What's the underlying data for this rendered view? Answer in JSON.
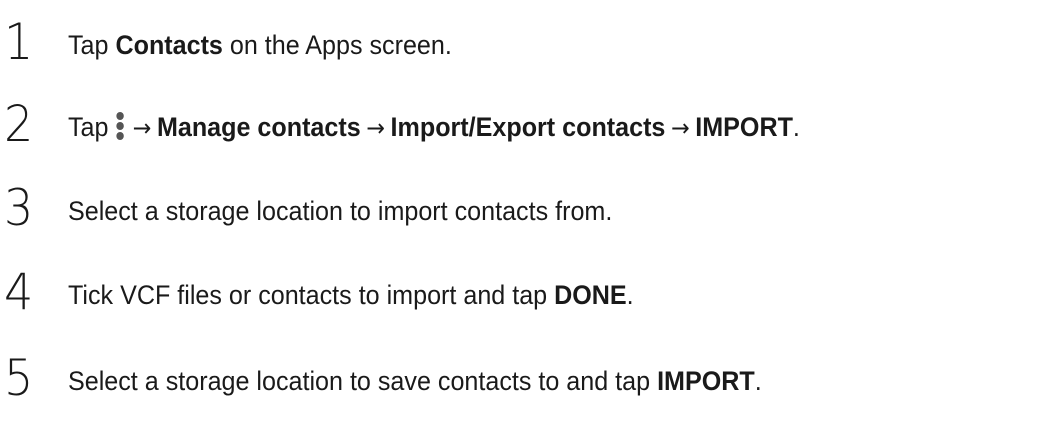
{
  "steps": [
    {
      "number": "1",
      "parts": {
        "t1": "Tap ",
        "b1": "Contacts",
        "t2": " on the Apps screen."
      }
    },
    {
      "number": "2",
      "parts": {
        "t1": "Tap",
        "icon": "more-options-icon",
        "arrow": "→",
        "b1": "Manage contacts",
        "b2": "Import/Export contacts",
        "b3": "IMPORT",
        "end": "."
      }
    },
    {
      "number": "3",
      "parts": {
        "t1": "Select a storage location to import contacts from."
      }
    },
    {
      "number": "4",
      "parts": {
        "t1": "Tick VCF files or contacts to import and tap ",
        "b1": "DONE",
        "end": "."
      }
    },
    {
      "number": "5",
      "parts": {
        "t1": "Select a storage location to save contacts to and tap ",
        "b1": "IMPORT",
        "end": "."
      }
    }
  ]
}
